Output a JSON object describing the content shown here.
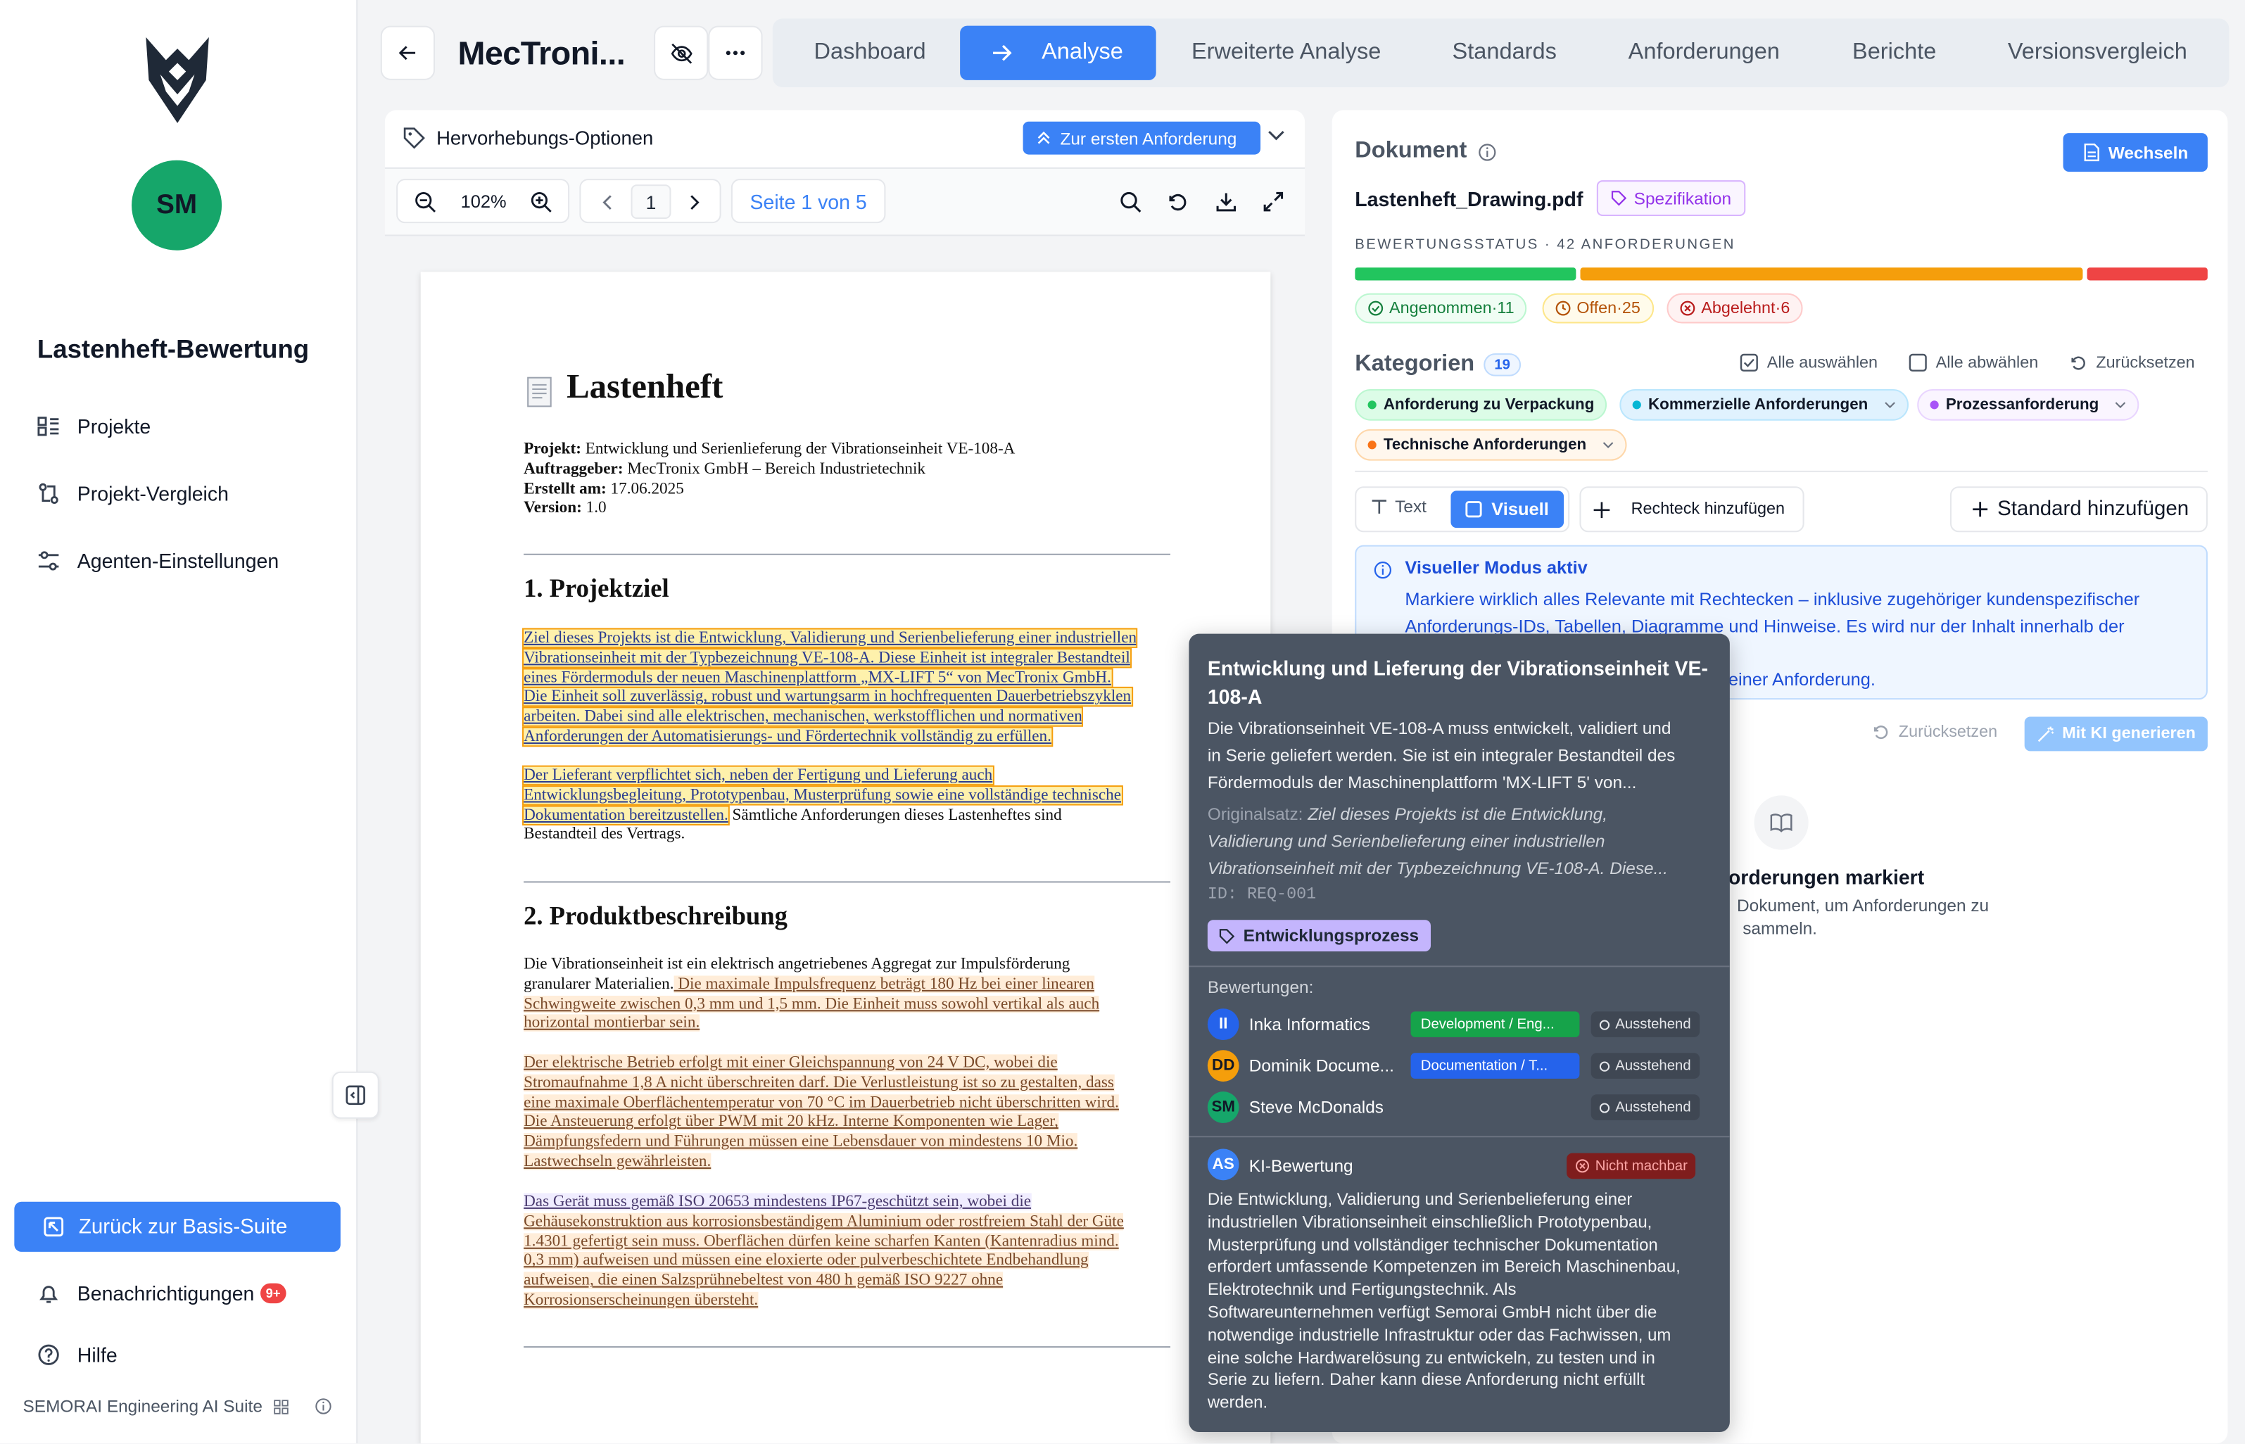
{
  "sidebar": {
    "avatar_initials": "SM",
    "title": "Lastenheft-Bewertung",
    "items": [
      {
        "label": "Projekte",
        "icon": "list-icon"
      },
      {
        "label": "Projekt-Vergleich",
        "icon": "compare-icon"
      },
      {
        "label": "Agenten-Einstellungen",
        "icon": "sliders-icon"
      }
    ],
    "back_label": "Zurück zur Basis-Suite",
    "notifications_label": "Benachrichtigungen",
    "notifications_badge": "9+",
    "help_label": "Hilfe",
    "footer": "SEMORAI Engineering AI Suite"
  },
  "header": {
    "project_title": "MecTroni...",
    "tabs": [
      "Dashboard",
      "Analyse",
      "Erweiterte Analyse",
      "Standards",
      "Anforderungen",
      "Berichte",
      "Versionsvergleich"
    ],
    "active_tab": "Analyse"
  },
  "viewer": {
    "highlight_options": "Hervorhebungs-Optionen",
    "first_req_button": "Zur ersten Anforderung",
    "zoom": "102%",
    "page_input": "1",
    "page_label": "Seite 1 von 5"
  },
  "pdf": {
    "title": "Lastenheft",
    "meta": [
      {
        "k": "Projekt:",
        "v": " Entwicklung und Serienlieferung der Vibrationseinheit VE-108-A"
      },
      {
        "k": "Auftraggeber:",
        "v": " MecTronix GmbH – Bereich Industrietechnik"
      },
      {
        "k": "Erstellt am:",
        "v": " 17.06.2025"
      },
      {
        "k": "Version:",
        "v": " 1.0"
      }
    ],
    "h1": "1. Projektziel",
    "p1": [
      "Ziel dieses Projekts ist die Entwicklung, Validierung und Serienbelieferung einer industriellen",
      "Vibrationseinheit mit der Typbezeichnung VE-108-A. Diese Einheit ist integraler Bestandteil",
      "eines Fördermoduls der neuen Maschinenplattform „MX-LIFT 5“ von MecTronix GmbH.",
      "Die Einheit soll zuverlässig, robust und wartungsarm in hochfrequenten Dauerbetriebszyklen",
      "arbeiten. Dabei sind alle elektrischen, mechanischen, werkstofflichen und normativen",
      "Anforderungen der Automatisierungs- und Fördertechnik vollständig zu erfüllen."
    ],
    "p2": [
      "Der Lieferant verpflichtet sich, neben der Fertigung und Lieferung auch",
      "Entwicklungsbegleitung, Prototypenbau, Musterprüfung sowie eine vollständige technische",
      "Dokumentation bereitzustellen."
    ],
    "p2_tail": " Sämtliche Anforderungen dieses Lastenheftes sind",
    "p2_last": "Bestandteil des Vertrags.",
    "h2": "2. Produktbeschreibung",
    "p3_plain1": "Die Vibrationseinheit ist ein elektrisch angetriebenes Aggregat zur Impulsförderung",
    "p3_plain2": "granularer Materialien.",
    "p3_hl": [
      " Die maximale Impulsfrequenz beträgt 180 Hz bei einer linearen",
      "Schwingweite zwischen 0,3 mm und 1,5 mm. Die Einheit muss sowohl vertikal als auch",
      "horizontal montierbar sein."
    ],
    "p4": [
      "Der elektrische Betrieb erfolgt mit einer Gleichspannung von 24 V DC, wobei die",
      "Stromaufnahme 1,8 A nicht überschreiten darf. Die Verlustleistung ist so zu gestalten, dass",
      "eine maximale Oberflächentemperatur von 70 °C im Dauerbetrieb nicht überschritten wird.",
      "Die Ansteuerung erfolgt über PWM mit 20 kHz. Interne Komponenten wie Lager,",
      "Dämpfungsfedern und Führungen müssen eine Lebensdauer von mindestens 10 Mio.",
      "Lastwechseln gewährleisten."
    ],
    "p5": [
      "Das Gerät muss gemäß ISO 20653 mindestens IP67-geschützt sein, wobei die",
      "Gehäusekonstruktion aus korrosionsbeständigem Aluminium oder rostfreiem Stahl der Güte",
      "1.4301 gefertigt sein muss. Oberflächen dürfen keine scharfen Kanten (Kantenradius mind.",
      "0,3 mm) aufweisen und müssen eine eloxierte oder pulverbeschichtete Endbehandlung",
      "aufweisen, die einen Salzsprühnebeltest von 480 h gemäß ISO 9227 ohne",
      "Korrosionserscheinungen übersteht."
    ]
  },
  "right": {
    "doc_label": "Dokument",
    "switch_button": "Wechseln",
    "filename": "Lastenheft_Drawing.pdf",
    "doc_tag": "Spezifikation",
    "status_heading": "BEWERTUNGSSTATUS · 42 ANFORDERUNGEN",
    "status": {
      "accepted": 11,
      "open": 25,
      "rejected": 6
    },
    "accepted_label": "Angenommen·11",
    "open_label": "Offen·25",
    "rejected_label": "Abgelehnt·6",
    "categories_label": "Kategorien",
    "categories_count": "19",
    "select_all": "Alle auswählen",
    "deselect_all": "Alle abwählen",
    "reset": "Zurücksetzen",
    "categories": [
      {
        "label": "Anforderung zu Verpackung",
        "color": "#22c55e",
        "bg": "#dcfce7"
      },
      {
        "label": "Kommerzielle Anforderungen",
        "color": "#06b6d4",
        "bg": "#e0f2fe"
      },
      {
        "label": "Prozessanforderung",
        "color": "#a855f7",
        "bg": "#f3e8ff"
      },
      {
        "label": "Technische Anforderungen",
        "color": "#f97316",
        "bg": "#ffedd5"
      }
    ],
    "mode_text": "Text",
    "mode_visual": "Visuell",
    "add_rect": "Rechteck hinzufügen",
    "add_standard": "Standard hinzufügen",
    "info_title": "Visueller Modus aktiv",
    "info_lines": [
      "Markiere wirklich alles Relevante mit Rechtecken – inklusive zugehöriger kundenspezifischer",
      "Anforderungs-IDs, Tabellen, Diagramme und Hinweise. Es wird nur der Inhalt innerhalb der"
    ],
    "info_tail": " einer Anforderung.",
    "reset2": "Zurücksetzen",
    "ai_generate": "Mit KI generieren",
    "empty_title": "orderungen markiert",
    "empty_sub1": "Dokument, um Anforderungen zu",
    "empty_sub2": "sammeln."
  },
  "tooltip": {
    "title1": "Entwicklung und Lieferung der Vibrationseinheit VE-",
    "title2": "108-A",
    "desc": [
      "Die Vibrationseinheit VE-108-A muss entwickelt, validiert und",
      "in Serie geliefert werden. Sie ist ein integraler Bestandteil des",
      "Fördermoduls der Maschinenplattform 'MX-LIFT 5' von..."
    ],
    "orig_label": "Originalsatz:",
    "orig": [
      " Ziel dieses Projekts ist die Entwicklung,",
      "Validierung und Serienbelieferung einer industriellen",
      "Vibrationseinheit mit der Typbezeichnung VE-108-A. Diese..."
    ],
    "id": "ID: REQ-001",
    "tag": "Entwicklungsprozess",
    "reviews_label": "Bewertungen:",
    "reviewers": [
      {
        "initials": "II",
        "name": "Inka Informatics",
        "role": "Development / Eng...",
        "role_color": "#16a34a",
        "status": "Ausstehend",
        "avatar_bg": "#2563eb",
        "avatar_fg": "#fff"
      },
      {
        "initials": "DD",
        "name": "Dominik Docume...",
        "role": "Documentation / T...",
        "role_color": "#2563eb",
        "status": "Ausstehend",
        "avatar_bg": "#f59e0b",
        "avatar_fg": "#111827"
      },
      {
        "initials": "SM",
        "name": "Steve McDonalds",
        "role": "",
        "role_color": "",
        "status": "Ausstehend",
        "avatar_bg": "#16a66a",
        "avatar_fg": "#111827"
      }
    ],
    "ai_initials": "AS",
    "ai_label": "KI-Bewertung",
    "ai_status": "Nicht machbar",
    "ai_text": [
      "Die Entwicklung, Validierung und Serienbelieferung einer",
      "industriellen Vibrationseinheit einschließlich Prototypenbau,",
      "Musterprüfung und vollständiger technischer Dokumentation",
      "erfordert umfassende Kompetenzen im Bereich Maschinenbau,",
      "Elektrotechnik und Fertigungstechnik. Als",
      "Softwareunternehmen verfügt Semorai GmbH nicht über die",
      "notwendige industrielle Infrastruktur oder das Fachwissen, um",
      "eine solche Hardwarelösung zu entwickeln, zu testen und in",
      "Serie zu liefern. Daher kann diese Anforderung nicht erfüllt",
      "werden."
    ]
  }
}
